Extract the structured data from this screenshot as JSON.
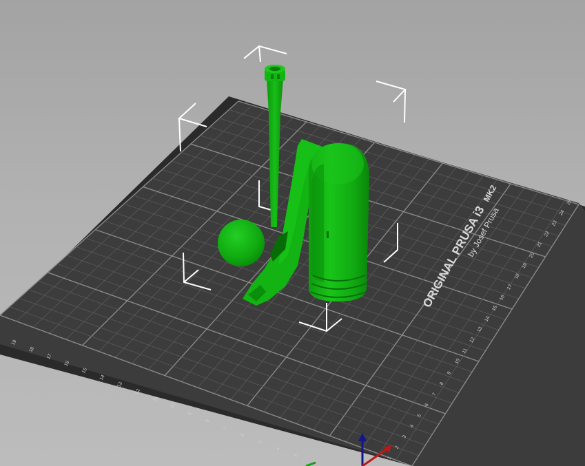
{
  "bed": {
    "brand_line": "ORIGINAL PRUSA i3",
    "model_line": "MK2",
    "byline": "by Josef Prusa",
    "right_edge_numbers": [
      "25",
      "24",
      "23",
      "22",
      "21",
      "20",
      "19",
      "18",
      "17",
      "16",
      "15",
      "14",
      "13",
      "12",
      "11",
      "10",
      "9",
      "8",
      "7",
      "6",
      "5",
      "4",
      "3",
      "2",
      "1"
    ],
    "bottom_edge_numbers": [
      "19",
      "18",
      "17",
      "16",
      "15",
      "14",
      "13",
      "12",
      "11",
      "10",
      "9",
      "8",
      "7",
      "6",
      "5",
      "4",
      "3"
    ]
  },
  "colors": {
    "background_top": "#a3a3a3",
    "background_bottom": "#bcbcbc",
    "bed_surface": "#3c3c3c",
    "bed_edge": "#2a2a2a",
    "grid_minor": "#5a5a5a",
    "grid_major": "#8a8a8a",
    "model_green": "#13b513",
    "model_green_dark": "#0a8a0a",
    "selection_box": "#ffffff",
    "axis_x": "#c01616",
    "axis_y": "#12a012",
    "axis_z": "#14148c"
  },
  "objects": [
    {
      "name": "thin-rod-with-cap"
    },
    {
      "name": "sphere"
    },
    {
      "name": "curved-handle-part"
    },
    {
      "name": "cylindrical-body"
    }
  ],
  "axes_gizmo": {
    "labels": [
      "x",
      "y",
      "z"
    ]
  }
}
